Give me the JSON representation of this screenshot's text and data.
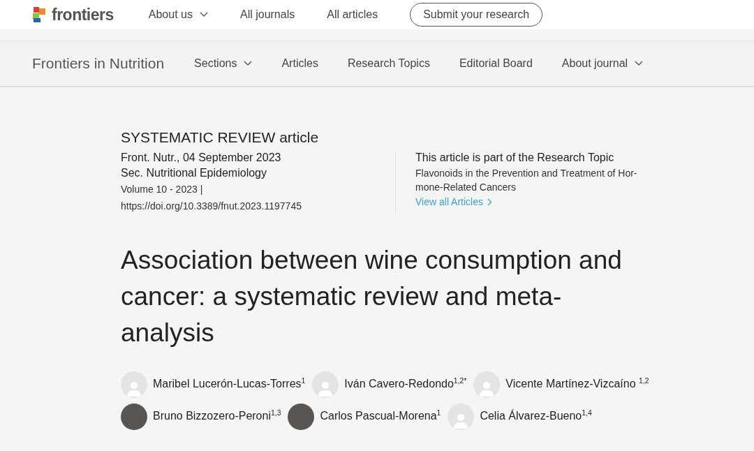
{
  "top_nav": {
    "logo": "frontiers",
    "items": [
      {
        "label": "About us",
        "dropdown": true
      },
      {
        "label": "All journals",
        "dropdown": false
      },
      {
        "label": "All articles",
        "dropdown": false
      }
    ],
    "button": "Submit your research"
  },
  "journal_nav": {
    "title": "Frontiers in Nutrition",
    "items": [
      {
        "label": "Sections",
        "dropdown": true
      },
      {
        "label": "Articles",
        "dropdown": false
      },
      {
        "label": "Research Topics",
        "dropdown": false
      },
      {
        "label": "Editorial Board",
        "dropdown": false
      },
      {
        "label": "About journal",
        "dropdown": true
      }
    ]
  },
  "article": {
    "type": "SYSTEMATIC REVIEW article",
    "journal_date": "Front. Nutr., 04 September 2023",
    "section": "Sec. Nutritional Epidemiology",
    "volume": "Volume 10 - 2023 |",
    "doi": "https://doi.org/10.3389/fnut.2023.1197745",
    "research_topic": {
      "heading": "This article is part of the Research Topic",
      "name": "Flavonoids in the Prevention and Treatment of Hor-mone-Related Cancers",
      "link": "View all Articles"
    },
    "title": "Association between wine consumption and cancer: a systematic review and meta-analysis",
    "authors": [
      {
        "name": "Maribel Lucerón-Lucas-Torres$^{1}$",
        "kind": "placeholder"
      },
      {
        "name": "Iván Cavero-Redondo$^{1,2*}$",
        "kind": "placeholder"
      },
      {
        "name": "Vicente Martínez-Vizcaíno $^{1,2}$",
        "kind": "placeholder"
      },
      {
        "name": "Bruno Bizzozero-Peroni$^{1,3}$",
        "kind": "photo"
      },
      {
        "name": "Carlos Pascual-Morena$^{1}$",
        "kind": "photo"
      },
      {
        "name": "Celia Álvarez-Bueno$^{1,4}$",
        "kind": "placeholder"
      }
    ]
  }
}
